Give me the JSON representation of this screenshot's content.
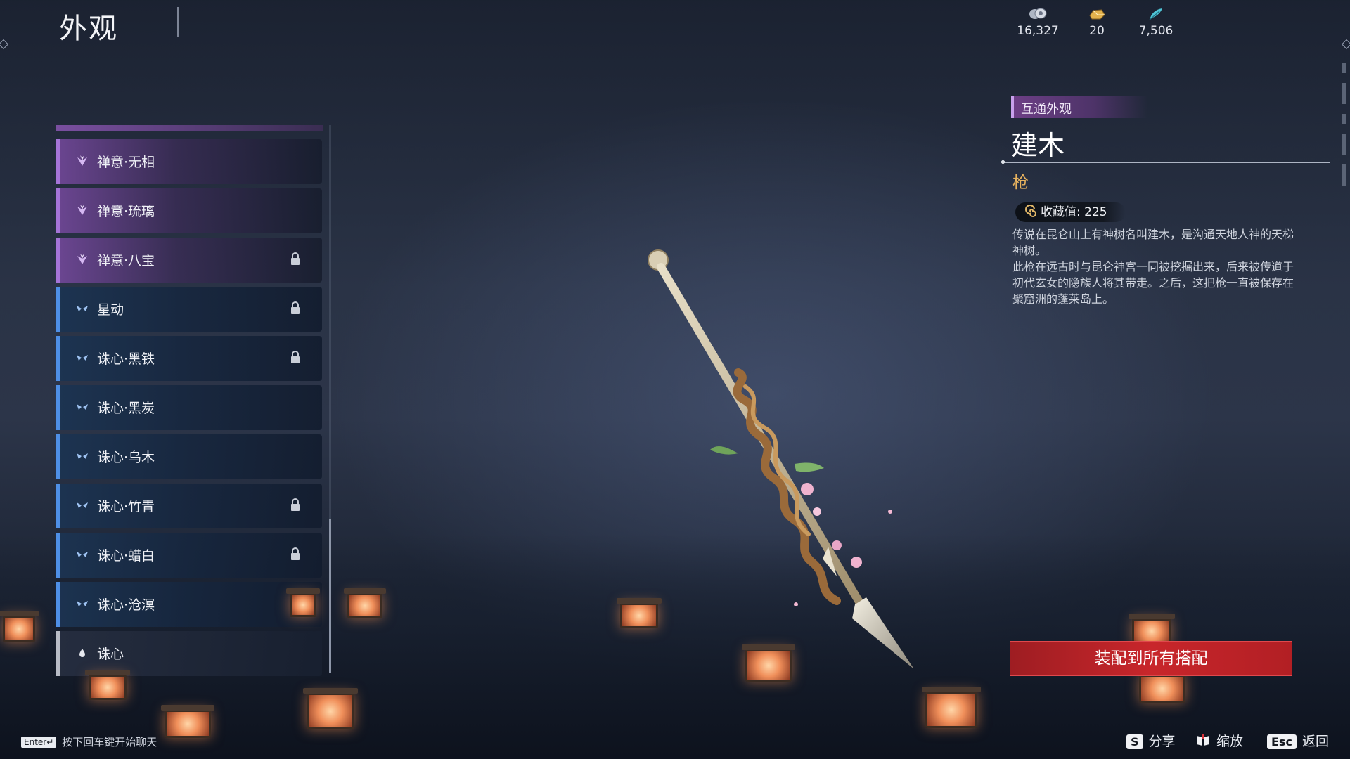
{
  "header": {
    "title": "外观",
    "currencies": [
      {
        "icon": "coin-stack-icon",
        "value": "16,327"
      },
      {
        "icon": "gold-ingot-icon",
        "value": "20"
      },
      {
        "icon": "jade-feather-icon",
        "value": "7,506"
      }
    ]
  },
  "list": {
    "items": [
      {
        "name": "禅意·无相",
        "tier": "purple",
        "locked": false
      },
      {
        "name": "禅意·琉璃",
        "tier": "purple",
        "locked": false
      },
      {
        "name": "禅意·八宝",
        "tier": "purple",
        "locked": true
      },
      {
        "name": "星动",
        "tier": "blue",
        "locked": true
      },
      {
        "name": "诛心·黑铁",
        "tier": "blue",
        "locked": true
      },
      {
        "name": "诛心·黑炭",
        "tier": "blue",
        "locked": false
      },
      {
        "name": "诛心·乌木",
        "tier": "blue",
        "locked": false
      },
      {
        "name": "诛心·竹青",
        "tier": "blue",
        "locked": true
      },
      {
        "name": "诛心·蜡白",
        "tier": "blue",
        "locked": true
      },
      {
        "name": "诛心·沧溟",
        "tier": "blue",
        "locked": false
      },
      {
        "name": "诛心",
        "tier": "white",
        "locked": false
      }
    ]
  },
  "detail": {
    "tag": "互通外观",
    "title": "建木",
    "type": "枪",
    "collect_value": "收藏值: 225",
    "description": [
      "传说在昆仑山上有神树名叫建木，是沟通天地人神的天梯神树。",
      "此枪在远古时与昆仑神宫一同被挖掘出来，后来被传道于初代玄女的隐族人将其带走。之后，这把枪一直被保存在聚窟洲的蓬莱岛上。"
    ],
    "equip_button": "装配到所有搭配"
  },
  "footer": {
    "enter_key": "Enter↵",
    "chat_hint": "按下回车键开始聊天",
    "actions": [
      {
        "key": "S",
        "label": "分享"
      },
      {
        "key": "",
        "icon": "book-icon",
        "label": "缩放"
      },
      {
        "key": "Esc",
        "label": "返回"
      }
    ]
  },
  "colors": {
    "purple_tier": "#a574d8",
    "blue_tier": "#4e8fe6",
    "white_tier": "#b8bcc6",
    "equip_red": "#c8262b",
    "type_gold": "#e7b25e"
  }
}
